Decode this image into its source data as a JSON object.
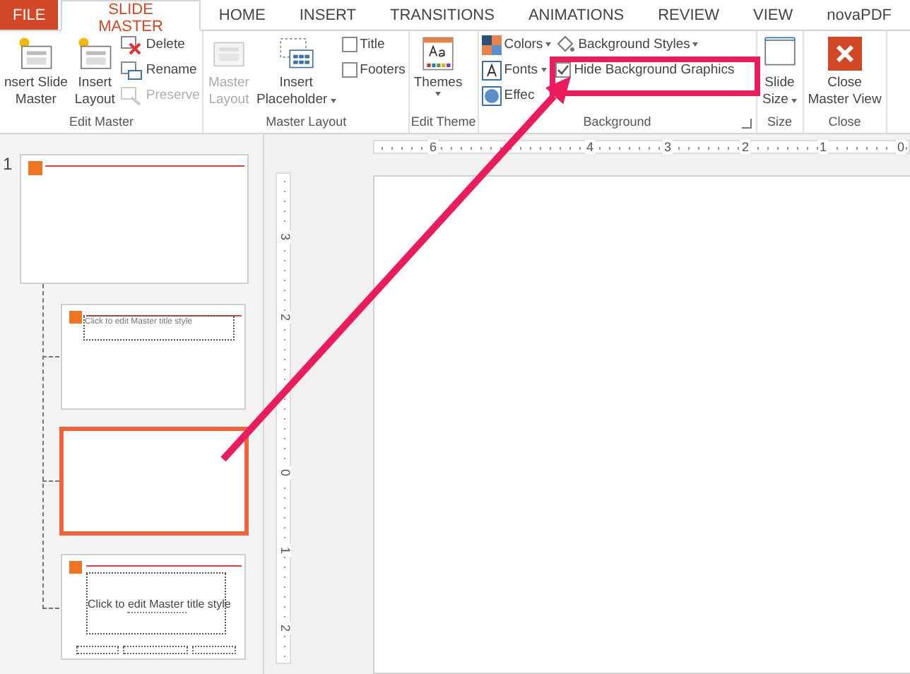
{
  "tabs": [
    {
      "label": "FILE",
      "kind": "file",
      "selected": false
    },
    {
      "label": "SLIDE MASTER",
      "kind": "tab",
      "selected": true
    },
    {
      "label": "HOME",
      "kind": "tab",
      "selected": false
    },
    {
      "label": "INSERT",
      "kind": "tab",
      "selected": false
    },
    {
      "label": "TRANSITIONS",
      "kind": "tab",
      "selected": false
    },
    {
      "label": "ANIMATIONS",
      "kind": "tab",
      "selected": false
    },
    {
      "label": "REVIEW",
      "kind": "tab",
      "selected": false
    },
    {
      "label": "VIEW",
      "kind": "tab",
      "selected": false
    },
    {
      "label": "novaPDF",
      "kind": "tab",
      "selected": false
    }
  ],
  "ribbon": {
    "groups": [
      {
        "label": "Edit Master",
        "items": [
          {
            "kind": "large",
            "lines": [
              "nsert Slide",
              "Master"
            ],
            "dropdown": false,
            "disabled": false
          },
          {
            "kind": "large",
            "lines": [
              "Insert",
              "Layout"
            ],
            "dropdown": false,
            "disabled": false
          },
          {
            "kind": "stack",
            "items": [
              {
                "kind": "button",
                "label": "Delete",
                "dropdown": false,
                "disabled": false
              },
              {
                "kind": "button",
                "label": "Rename",
                "dropdown": false,
                "disabled": false
              },
              {
                "kind": "button",
                "label": "Preserve",
                "dropdown": false,
                "disabled": true
              }
            ]
          }
        ]
      },
      {
        "label": "Master Layout",
        "items": [
          {
            "kind": "large",
            "lines": [
              "Master",
              "Layout"
            ],
            "dropdown": false,
            "disabled": true
          },
          {
            "kind": "large",
            "lines": [
              "Insert",
              "Placeholder"
            ],
            "dropdown": true,
            "disabled": false
          },
          {
            "kind": "stack",
            "items": [
              {
                "kind": "check",
                "label": "Title",
                "checked": false,
                "disabled": false
              },
              {
                "kind": "check",
                "label": "Footers",
                "checked": false,
                "disabled": false
              }
            ]
          }
        ]
      },
      {
        "label": "Edit Theme",
        "items": [
          {
            "kind": "large",
            "lines": [
              "Themes"
            ],
            "dropdown": true,
            "disabled": false
          }
        ]
      },
      {
        "label": "Background",
        "launcher": true,
        "items": [
          {
            "kind": "stack",
            "items": [
              {
                "kind": "button",
                "label": "Colors",
                "dropdown": true,
                "disabled": false
              },
              {
                "kind": "button",
                "label": "Fonts",
                "dropdown": true,
                "disabled": false
              },
              {
                "kind": "button",
                "label": "Effec",
                "dropdown": false,
                "disabled": false
              }
            ]
          },
          {
            "kind": "stack",
            "items": [
              {
                "kind": "button",
                "label": "Background Styles",
                "dropdown": true,
                "disabled": false
              },
              {
                "kind": "check",
                "label": "Hide Background Graphics",
                "checked": true,
                "disabled": false
              }
            ]
          }
        ]
      },
      {
        "label": "Size",
        "items": [
          {
            "kind": "large",
            "lines": [
              "Slide",
              "Size"
            ],
            "dropdown": true,
            "disabled": false
          }
        ]
      },
      {
        "label": "Close",
        "items": [
          {
            "kind": "large",
            "lines": [
              "Close",
              "Master View"
            ],
            "dropdown": false,
            "disabled": false
          }
        ]
      }
    ]
  },
  "thumbnails": [
    {
      "kind": "master",
      "number": "1",
      "selected": false
    },
    {
      "kind": "title-top",
      "title": "Click to edit Master title style",
      "selected": false
    },
    {
      "kind": "blank",
      "selected": true
    },
    {
      "kind": "title-center",
      "title": "Click to edit Master title style",
      "selected": false
    }
  ],
  "horizontal_ruler": [
    "6",
    "4",
    "3",
    "2",
    "1",
    "0"
  ],
  "vertical_ruler": [
    "3",
    "2",
    "0",
    "1",
    "2"
  ]
}
